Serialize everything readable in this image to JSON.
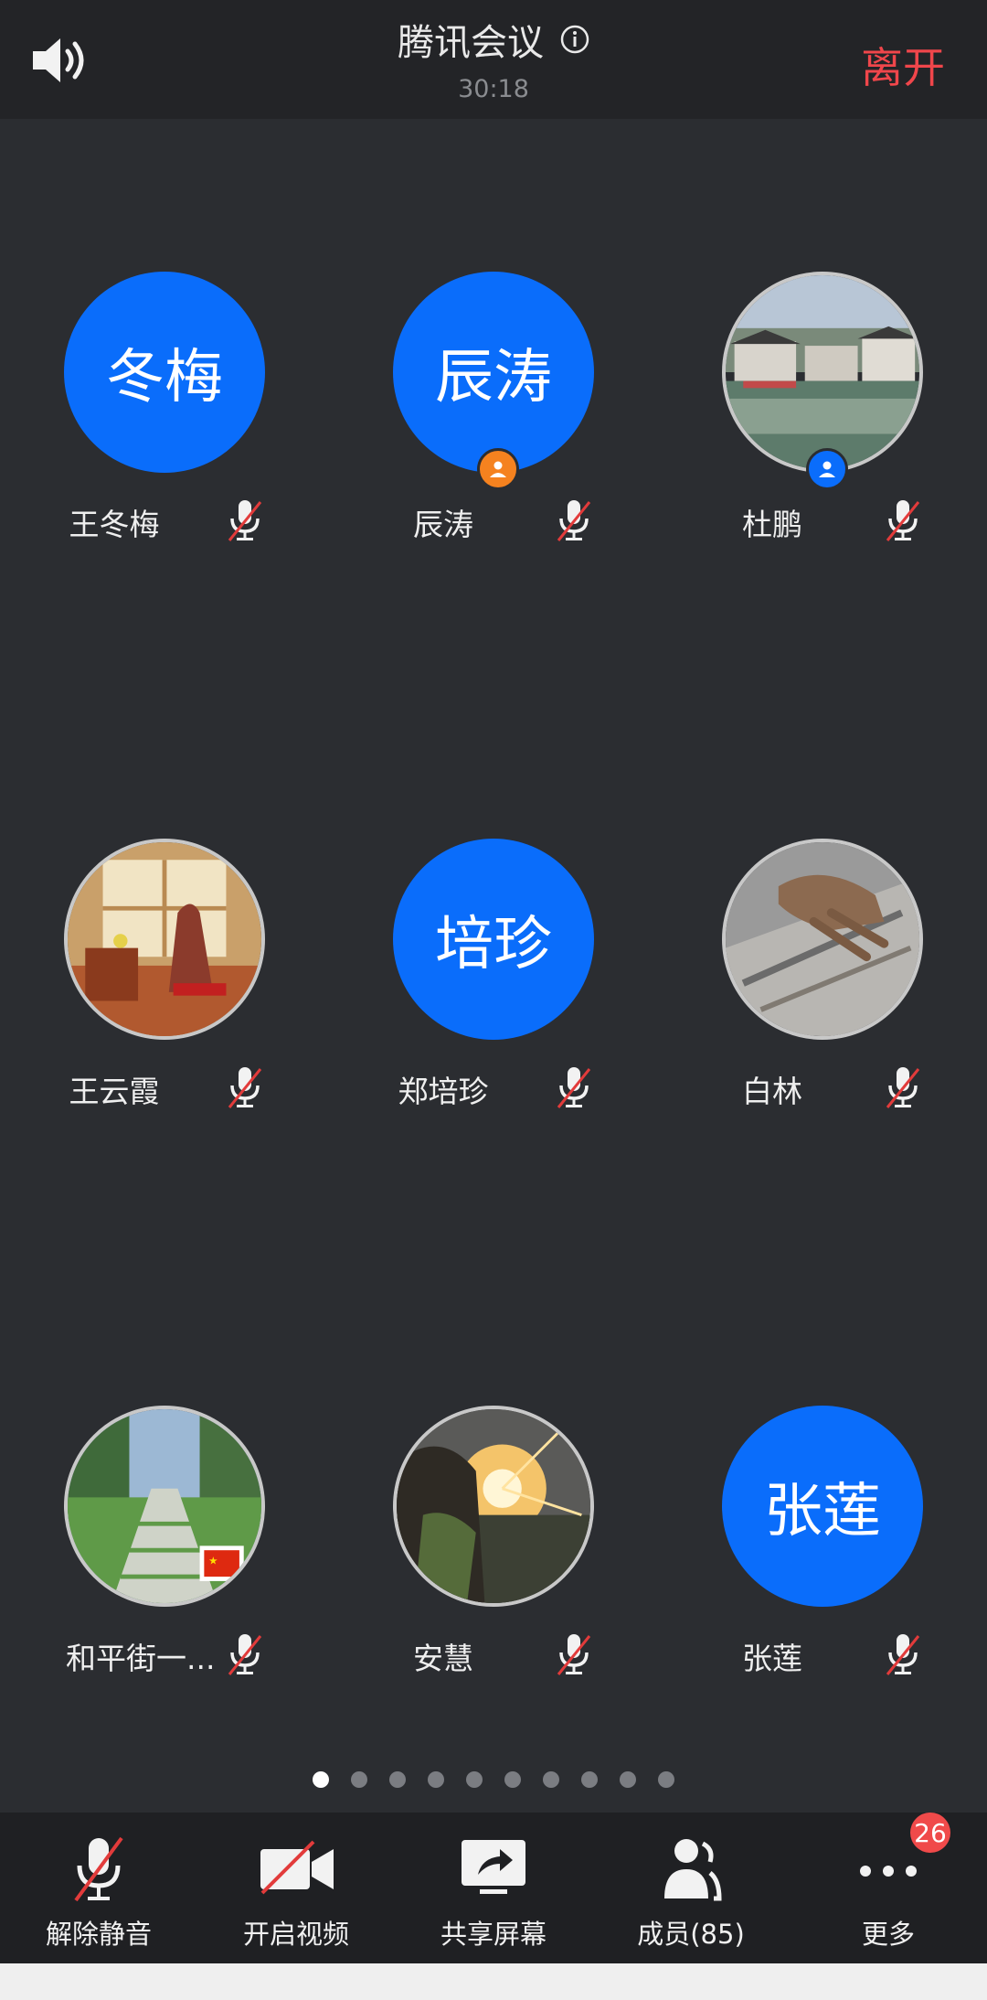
{
  "header": {
    "title": "腾讯会议",
    "timer": "30:18",
    "leave_label": "离开"
  },
  "participants": [
    {
      "name": "王冬梅",
      "avatar_text": "冬梅",
      "avatar_type": "initials"
    },
    {
      "name": "辰涛",
      "avatar_text": "辰涛",
      "avatar_type": "initials",
      "badge": "host"
    },
    {
      "name": "杜鹏",
      "avatar_type": "photo",
      "photo": "landscape-village",
      "badge": "co-host"
    },
    {
      "name": "王云霞",
      "avatar_type": "photo",
      "photo": "painting-woman-window"
    },
    {
      "name": "郑培珍",
      "avatar_text": "培珍",
      "avatar_type": "initials"
    },
    {
      "name": "白林",
      "avatar_type": "photo",
      "photo": "hand-on-rock"
    },
    {
      "name": "和平街一...",
      "avatar_type": "photo",
      "photo": "garden-path"
    },
    {
      "name": "安慧",
      "avatar_type": "photo",
      "photo": "sunset-portrait"
    },
    {
      "name": "张莲",
      "avatar_text": "张莲",
      "avatar_type": "initials"
    }
  ],
  "pagination": {
    "total": 10,
    "current": 1
  },
  "toolbar": {
    "unmute": "解除静音",
    "video": "开启视频",
    "share": "共享屏幕",
    "members": "成员(85)",
    "more": "更多",
    "more_badge": "26"
  },
  "colors": {
    "accent": "#0a6dfb",
    "leave": "#f0464b",
    "host_badge": "#f5821f",
    "badge_red": "#f04a4a"
  }
}
